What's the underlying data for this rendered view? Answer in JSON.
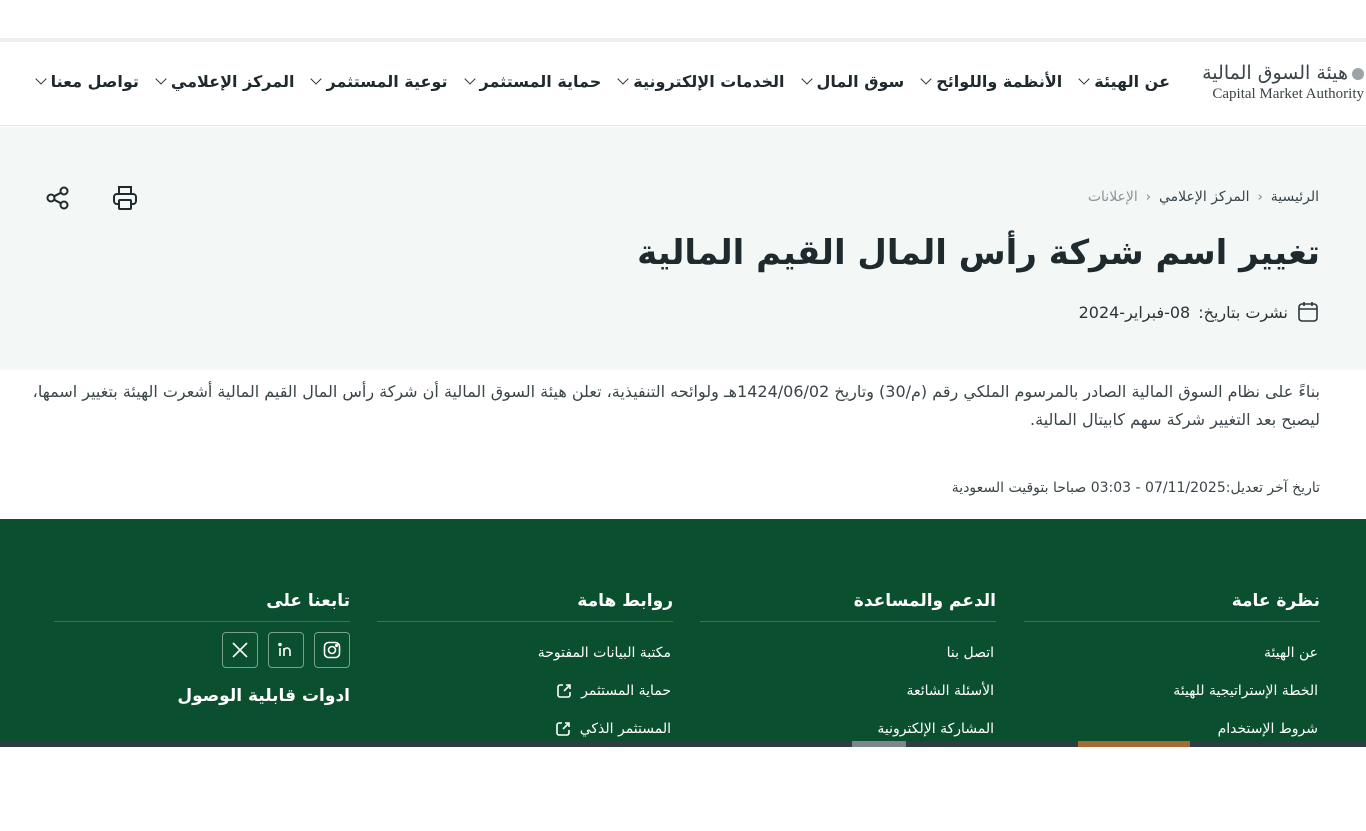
{
  "header": {
    "logo_ar": "هيئة السوق المالية",
    "logo_en": "Capital Market Authority",
    "menu": [
      {
        "label": "عن الهيئة"
      },
      {
        "label": "الأنظمة واللوائح"
      },
      {
        "label": "سوق المال"
      },
      {
        "label": "الخدمات الإلكترونية"
      },
      {
        "label": "حماية المستثمر"
      },
      {
        "label": "توعية المستثمر"
      },
      {
        "label": "المركز الإعلامي"
      },
      {
        "label": "تواصل معنا"
      }
    ]
  },
  "breadcrumb": {
    "items": [
      "الرئيسية",
      "المركز الإعلامي",
      "الإعلانات"
    ]
  },
  "article": {
    "title": "تغيير اسم شركة رأس المال القيم المالية",
    "published_label": "نشرت بتاريخ:",
    "published_date": "08-فبراير-2024",
    "body": "بناءً على نظام السوق المالية الصادر بالمرسوم الملكي رقم (م/30) وتاريخ 1424/06/02هـ ولوائحه التنفيذية، تعلن هيئة السوق المالية أن شركة رأس المال القيم المالية أشعرت الهيئة بتغيير اسمها، ليصبح بعد التغيير شركة سهم كابيتال المالية.",
    "last_modified": "تاريخ آخر تعديل:07/11/2025 - 03:03 صباحا بتوقيت السعودية"
  },
  "tools": {
    "print": "print-icon",
    "share": "share-icon"
  },
  "footer": {
    "overview": {
      "title": "نظرة عامة",
      "links": [
        "عن الهيئة",
        "الخطة الإستراتيجية للهيئة",
        "شروط الإستخدام"
      ]
    },
    "support": {
      "title": "الدعم والمساعدة",
      "links": [
        "اتصل بنا",
        "الأسئلة الشائعة",
        "المشاركة الإلكترونية"
      ]
    },
    "links": {
      "title": "روابط هامة",
      "links": [
        "مكتبة البيانات المفتوحة",
        "حماية المستثمر",
        "المستثمر الذكي"
      ]
    },
    "follow": {
      "title": "تابعنا على",
      "accessibility_title": "ادوات قابلية الوصول",
      "social": [
        "instagram-icon",
        "linkedin-icon",
        "x-icon"
      ]
    }
  },
  "colors": {
    "footer_bg": "#0a4f2e",
    "hero_bg": "#f3f8f6"
  }
}
